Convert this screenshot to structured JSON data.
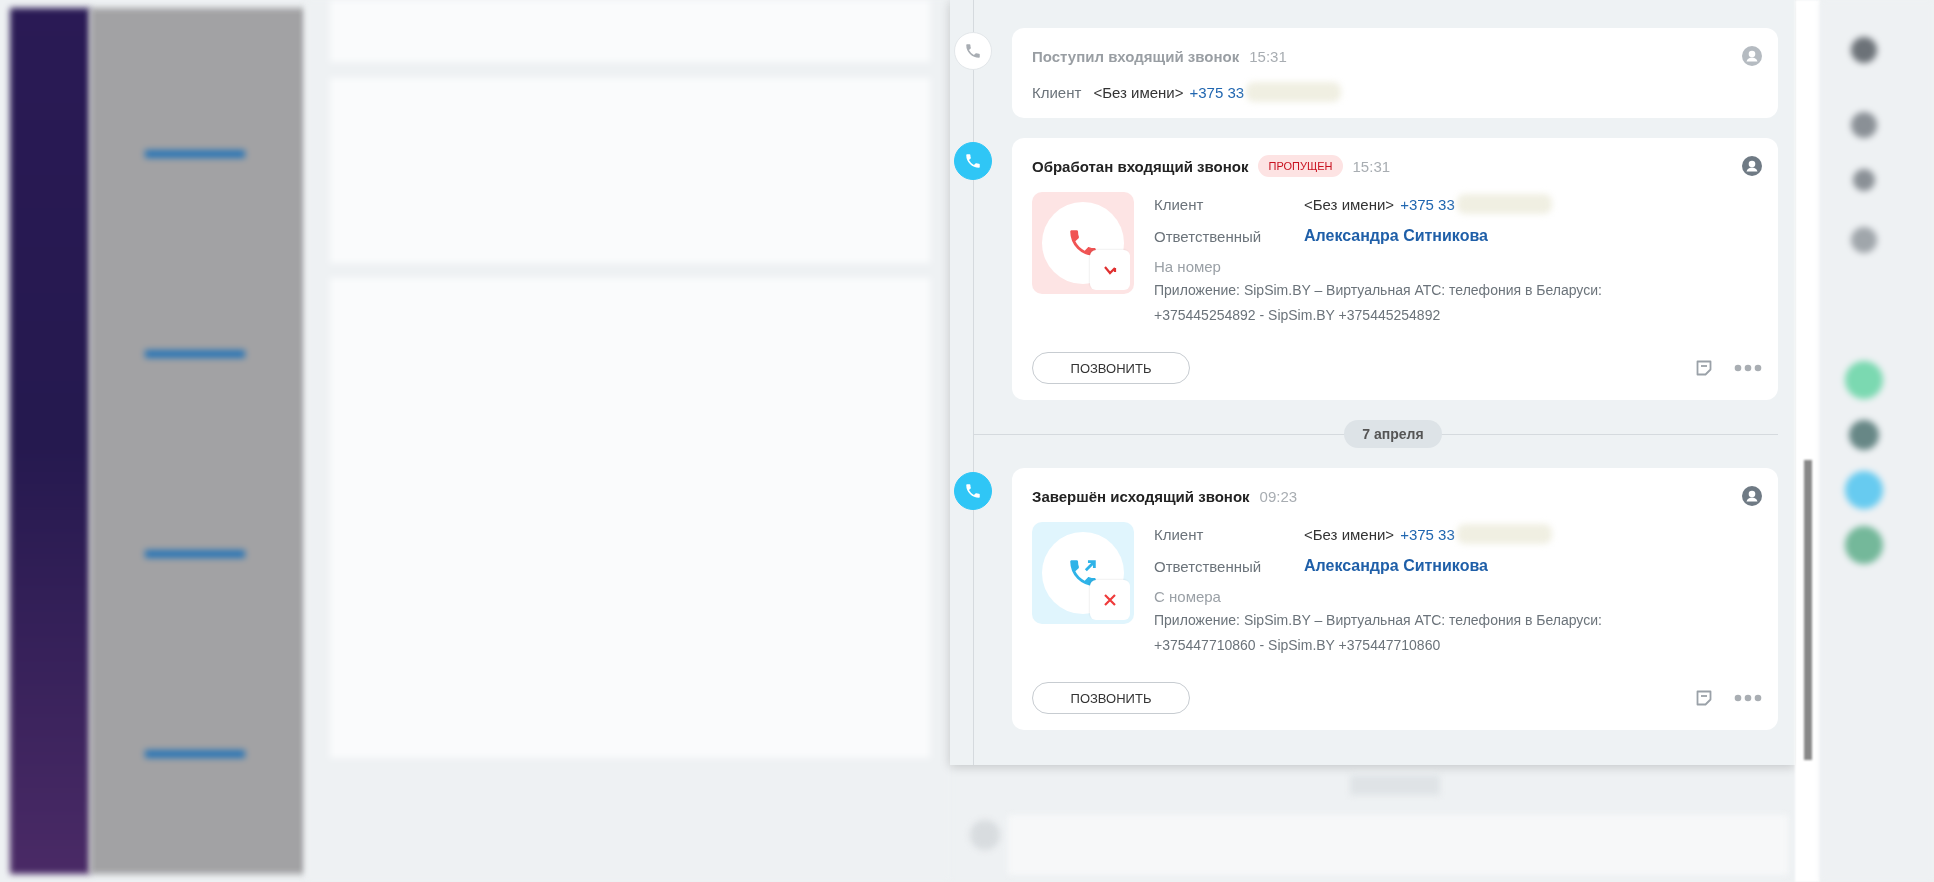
{
  "timeline": [
    {
      "kind": "brief",
      "highlighted": false,
      "title": "Поступил входящий звонок",
      "time": "15:31",
      "client_label": "Клиент",
      "client_name": "<Без имени>",
      "client_phone": "+375 33"
    },
    {
      "kind": "full",
      "highlighted": true,
      "picture": {
        "kind": "incoming-missed"
      },
      "title": "Обработан входящий звонок",
      "badge": "ПРОПУЩЕН",
      "time": "15:31",
      "client_label": "Клиент",
      "client_name": "<Без имени>",
      "client_phone": "+375 33",
      "owner_label": "Ответственный",
      "owner_name": "Александра Ситникова",
      "number_label": "На номер",
      "app_text": "Приложение: SipSim.BY – Виртуальная АТС: телефония в Беларуси: +375445254892 - SipSim.BY +375445254892",
      "button": "ПОЗВОНИТЬ"
    },
    {
      "kind": "date",
      "label": "7 апреля"
    },
    {
      "kind": "full",
      "highlighted": true,
      "picture": {
        "kind": "outgoing-failed"
      },
      "title": "Завершён исходящий звонок",
      "time": "09:23",
      "client_label": "Клиент",
      "client_name": "<Без имени>",
      "client_phone": "+375 33",
      "owner_label": "Ответственный",
      "owner_name": "Александра Ситникова",
      "number_label": "С номера",
      "app_text": "Приложение: SipSim.BY – Виртуальная АТС: телефония в Беларуси: +375447710860 - SipSim.BY +375447710860",
      "button": "ПОЗВОНИТЬ"
    }
  ]
}
